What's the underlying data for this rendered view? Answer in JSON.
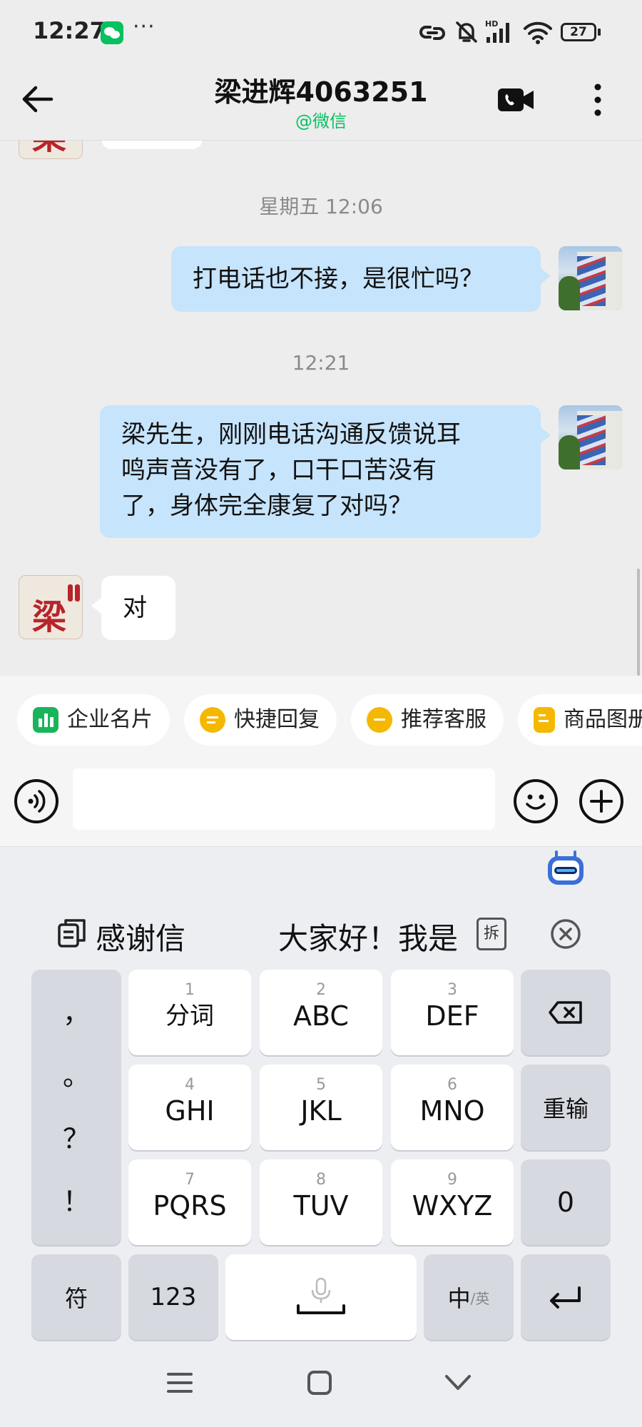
{
  "status_bar": {
    "time": "12:27",
    "overflow_dots": "···",
    "battery": "27"
  },
  "header": {
    "title": "梁进辉4063251",
    "subtitle": "@微信"
  },
  "chat": {
    "messages": [
      {
        "type": "timestamp",
        "text": "星期五  12:06"
      },
      {
        "type": "sent",
        "text": "打电话也不接，是很忙吗？"
      },
      {
        "type": "timestamp",
        "text": "12:21"
      },
      {
        "type": "sent",
        "lines": [
          "梁先生，刚刚电话沟通反馈说耳",
          "鸣声音没有了，口干口苦没有",
          "了，身体完全康复了对吗？"
        ]
      },
      {
        "type": "received",
        "text": "对"
      }
    ],
    "contact_avatar_text": "梁"
  },
  "quick_actions": [
    {
      "label": "企业名片",
      "icon": "business-card-icon",
      "color": "#19b45a"
    },
    {
      "label": "快捷回复",
      "icon": "quick-reply-icon",
      "color": "#f5b800"
    },
    {
      "label": "推荐客服",
      "icon": "recommend-service-icon",
      "color": "#f5b800"
    },
    {
      "label": "商品图册",
      "icon": "product-album-icon",
      "color": "#f5b800"
    }
  ],
  "input": {
    "placeholder": ""
  },
  "keyboard": {
    "candidates": [
      "感谢信",
      "大家好！我是"
    ],
    "split_key": "拆",
    "punctuation": [
      "，",
      "。",
      "？",
      "！"
    ],
    "keys": [
      {
        "num": "1",
        "label": "分词"
      },
      {
        "num": "2",
        "label": "ABC"
      },
      {
        "num": "3",
        "label": "DEF"
      },
      {
        "num": "4",
        "label": "GHI"
      },
      {
        "num": "5",
        "label": "JKL"
      },
      {
        "num": "6",
        "label": "MNO"
      },
      {
        "num": "7",
        "label": "PQRS"
      },
      {
        "num": "8",
        "label": "TUV"
      },
      {
        "num": "9",
        "label": "WXYZ"
      }
    ],
    "reinput": "重输",
    "zero": "0",
    "symbols": "符",
    "numbers": "123",
    "lang_main": "中",
    "lang_alt": "/英"
  }
}
